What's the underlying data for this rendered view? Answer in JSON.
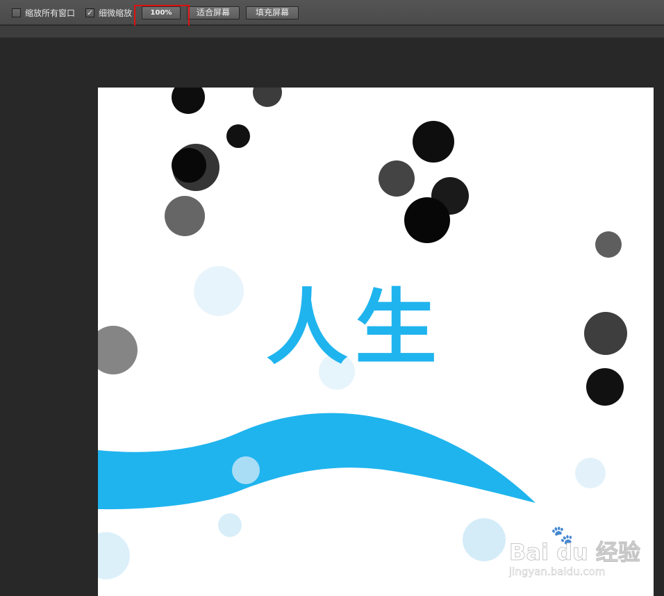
{
  "options_bar": {
    "zoom_all_windows": {
      "label": "缩放所有窗口",
      "checked": false
    },
    "scrubby_zoom": {
      "label": "细微缩放",
      "checked": true
    },
    "zoom_100_label": "100%",
    "fit_screen_label": "适合屏幕",
    "fill_screen_label": "填充屏幕"
  },
  "canvas": {
    "title": "人生",
    "accent_color": "#1fb4ee"
  },
  "watermark": {
    "brand": "Bai du 经验",
    "paw": "🐾",
    "url": "jingyan.baidu.com"
  },
  "colors": {
    "workspace": "#282828",
    "toolbar": "#4f4f4f",
    "highlight": "#e01010",
    "canvas": "#ffffff"
  }
}
